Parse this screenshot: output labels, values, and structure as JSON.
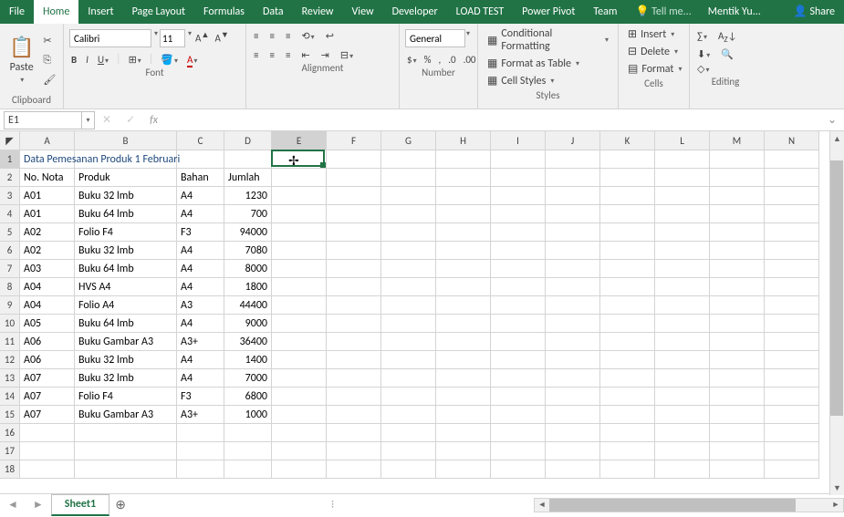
{
  "tabs": {
    "file": "File",
    "home": "Home",
    "insert": "Insert",
    "pagelayout": "Page Layout",
    "formulas": "Formulas",
    "data": "Data",
    "review": "Review",
    "view": "View",
    "developer": "Developer",
    "loadtest": "LOAD TEST",
    "powerpivot": "Power Pivot",
    "team": "Team",
    "tellme": "Tell me...",
    "user": "Mentik Yu...",
    "share": "Share"
  },
  "ribbon": {
    "clipboard": {
      "paste": "Paste",
      "label": "Clipboard"
    },
    "font": {
      "name": "Calibri",
      "size": "11",
      "label": "Font"
    },
    "alignment": {
      "label": "Alignment"
    },
    "number": {
      "format": "General",
      "label": "Number"
    },
    "styles": {
      "cf": "Conditional Formatting",
      "fat": "Format as Table",
      "cs": "Cell Styles",
      "label": "Styles"
    },
    "cells": {
      "insert": "Insert",
      "delete": "Delete",
      "format": "Format",
      "label": "Cells"
    },
    "editing": {
      "label": "Editing"
    }
  },
  "fbar": {
    "name": "E1",
    "fx": "fx",
    "formula": ""
  },
  "columns": [
    "A",
    "B",
    "C",
    "D",
    "E",
    "F",
    "G",
    "H",
    "I",
    "J",
    "K",
    "L",
    "M",
    "N"
  ],
  "title_row": "Data Pemesanan Produk 1 Februari",
  "headers": [
    "No. Nota",
    "Produk",
    "Bahan",
    "Jumlah"
  ],
  "rows": [
    {
      "no": "A01",
      "produk": "Buku 32 lmb",
      "bahan": "A4",
      "jumlah": "1230"
    },
    {
      "no": "A01",
      "produk": "Buku 64 lmb",
      "bahan": "A4",
      "jumlah": "700"
    },
    {
      "no": "A02",
      "produk": "Folio F4",
      "bahan": "F3",
      "jumlah": "94000"
    },
    {
      "no": "A02",
      "produk": "Buku 32 lmb",
      "bahan": "A4",
      "jumlah": "7080"
    },
    {
      "no": "A03",
      "produk": "Buku 64 lmb",
      "bahan": "A4",
      "jumlah": "8000"
    },
    {
      "no": "A04",
      "produk": "HVS A4",
      "bahan": "A4",
      "jumlah": "1800"
    },
    {
      "no": "A04",
      "produk": "Folio A4",
      "bahan": "A3",
      "jumlah": "44400"
    },
    {
      "no": "A05",
      "produk": "Buku 64 lmb",
      "bahan": "A4",
      "jumlah": "9000"
    },
    {
      "no": "A06",
      "produk": "Buku Gambar A3",
      "bahan": "A3+",
      "jumlah": "36400"
    },
    {
      "no": "A06",
      "produk": "Buku 32 lmb",
      "bahan": "A4",
      "jumlah": "1400"
    },
    {
      "no": "A07",
      "produk": "Buku 32 lmb",
      "bahan": "A4",
      "jumlah": "7000"
    },
    {
      "no": "A07",
      "produk": "Folio F4",
      "bahan": "F3",
      "jumlah": "6800"
    },
    {
      "no": "A07",
      "produk": "Buku Gambar A3",
      "bahan": "A3+",
      "jumlah": "1000"
    }
  ],
  "active_cell": {
    "col": 4,
    "row": 0
  },
  "sheet": {
    "name": "Sheet1"
  }
}
